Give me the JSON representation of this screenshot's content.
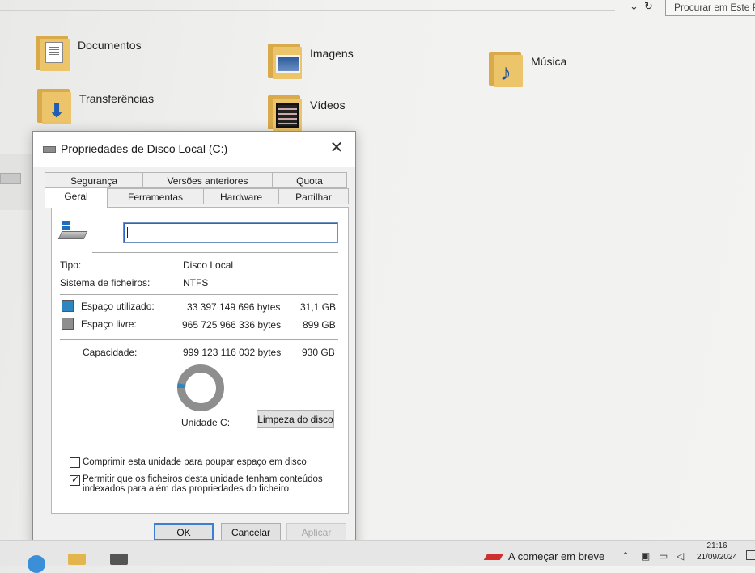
{
  "explorer": {
    "search_placeholder": "Procurar em Este PC",
    "nav": {
      "chevron": "⌄",
      "refresh": "↻"
    },
    "folders": [
      {
        "name": "Documentos",
        "icon": "documents-folder-icon"
      },
      {
        "name": "Imagens",
        "icon": "pictures-folder-icon"
      },
      {
        "name": "Música",
        "icon": "music-folder-icon"
      },
      {
        "name": "Transferências",
        "icon": "downloads-folder-icon"
      },
      {
        "name": "Vídeos",
        "icon": "videos-folder-icon"
      }
    ]
  },
  "dialog": {
    "title": "Propriedades de Disco Local (C:)",
    "close_glyph": "✕",
    "tabs": {
      "row_back": [
        "Segurança",
        "Versões anteriores",
        "Quota"
      ],
      "row_front": [
        "Geral",
        "Ferramentas",
        "Hardware",
        "Partilhar"
      ],
      "active": "Geral"
    },
    "general": {
      "name_value": "",
      "type_label": "Tipo:",
      "type_value": "Disco Local",
      "fs_label": "Sistema de ficheiros:",
      "fs_value": "NTFS",
      "used_label": "Espaço utilizado:",
      "used_bytes": "33 397 149 696 bytes",
      "used_size": "31,1 GB",
      "free_label": "Espaço livre:",
      "free_bytes": "965 725 966 336 bytes",
      "free_size": "899 GB",
      "capacity_label": "Capacidade:",
      "capacity_bytes": "999 123 116 032 bytes",
      "capacity_size": "930 GB",
      "drive_label": "Unidade C:",
      "cleanup_button": "Limpeza do disco",
      "compress_label": "Comprimir esta unidade para poupar espaço em disco",
      "compress_checked": false,
      "index_label_line1": "Permitir que os ficheiros desta unidade tenham conteúdos",
      "index_label_line2": "indexados para além das propriedades do ficheiro",
      "index_checked": true,
      "used_fraction": 0.0334
    },
    "buttons": {
      "ok": "OK",
      "cancel": "Cancelar",
      "apply": "Aplicar"
    }
  },
  "colors": {
    "used": "#2e86c1",
    "free": "#8e8e8e",
    "accent": "#3c7fd1"
  },
  "taskbar": {
    "news": "A começar em breve",
    "time": "21:16",
    "date": "21/09/2024"
  }
}
